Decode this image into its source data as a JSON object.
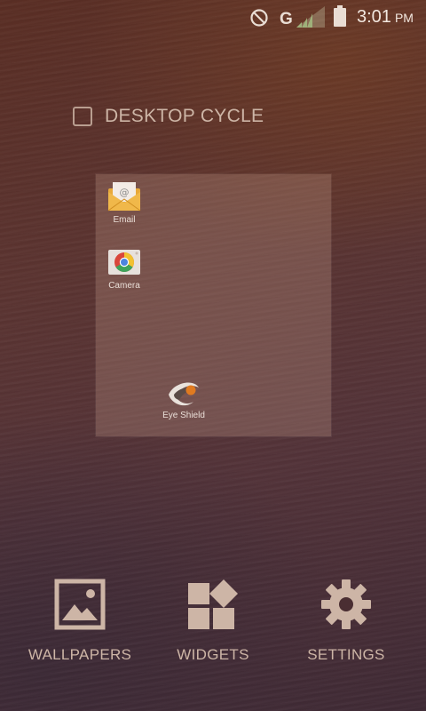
{
  "status_bar": {
    "network_type": "G",
    "time": "3:01",
    "ampm": "PM",
    "icons": [
      "do-not-disturb-icon",
      "signal-icon",
      "battery-icon"
    ]
  },
  "desktop_cycle": {
    "label": "DESKTOP CYCLE",
    "checked": false
  },
  "preview": {
    "apps": [
      {
        "label": "Email",
        "icon": "email-icon"
      },
      {
        "label": "Camera",
        "icon": "camera-icon"
      },
      {
        "label": "Eye Shield",
        "icon": "eye-shield-icon"
      }
    ]
  },
  "bottom_bar": {
    "wallpapers_label": "WALLPAPERS",
    "widgets_label": "WIDGETS",
    "settings_label": "SETTINGS"
  },
  "colors": {
    "accent_text": "#cdb5a6",
    "background": "#553235"
  }
}
